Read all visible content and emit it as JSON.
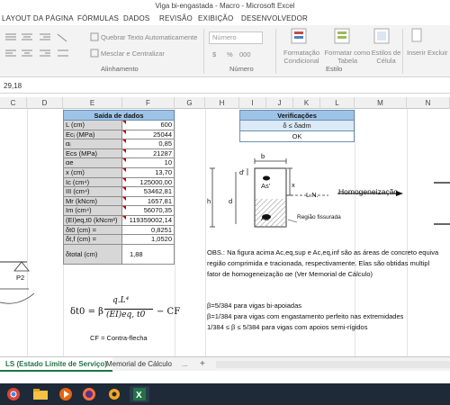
{
  "window": {
    "title": "Viga bi-engastada - Macro - Microsoft Excel"
  },
  "menu": [
    "LAYOUT DA PÁGINA",
    "FÓRMULAS",
    "DADOS",
    "REVISÃO",
    "EXIBIÇÃO",
    "DESENVOLVEDOR"
  ],
  "ribbon": {
    "wrap_text": "Quebrar Texto Automaticamente",
    "merge_center": "Mesclar e Centralizar",
    "number_format": "Número",
    "cond_format": "Formatação Condicional",
    "format_table": "Formatar como Tabela",
    "cell_styles": "Estilos de Célula",
    "insert": "Inserir",
    "delete": "Excluir",
    "group_alignment": "Alinhamento",
    "group_number": "Número",
    "group_style": "Estilo",
    "currency_symbol": "$",
    "percent_symbol": "%",
    "thousands_symbol": "000"
  },
  "formula_bar": {
    "name_box": "29,18"
  },
  "columns": [
    "C",
    "D",
    "E",
    "F",
    "G",
    "H",
    "I",
    "J",
    "K",
    "L",
    "M",
    "N"
  ],
  "output_table": {
    "header": "Saída de dados",
    "rows": [
      {
        "label": "L (cm)",
        "value": "600"
      },
      {
        "label": "Ecᵢ (MPa)",
        "value": "25044"
      },
      {
        "label": "αᵢ",
        "value": "0,85"
      },
      {
        "label": "Ecs (MPa)",
        "value": "21287"
      },
      {
        "label": "αe",
        "value": "10"
      },
      {
        "label": "x (cm)",
        "value": "13,70"
      },
      {
        "label": "Ic (cm⁴)",
        "value": "125000,00"
      },
      {
        "label": "III (cm⁴)",
        "value": "53462,81"
      },
      {
        "label": "Mr (kNcm)",
        "value": "1657,81"
      },
      {
        "label": "Im (cm⁴)",
        "value": "56070,35"
      },
      {
        "label": "(EI)eq,t0 (kNcm²)",
        "value": "119359002,14"
      },
      {
        "label": "δt0 (cm) =",
        "value": "0,8251"
      },
      {
        "label": "δt,f (cm) =",
        "value": "1,0520"
      },
      {
        "label": "δtotal (cm)",
        "value": "1,88"
      }
    ]
  },
  "verification": {
    "header": "Verificações",
    "condition": "δ ≤ δadm",
    "result": "OK"
  },
  "diagram": {
    "label_b": "b",
    "label_h": "h",
    "label_d": "d",
    "label_dprime": "d'",
    "label_x": "x",
    "label_as_prime": "As'",
    "label_as": "As",
    "label_ln": "L.N.",
    "label_cracked": "Região fissurada",
    "arrow_text": "Homogeneização"
  },
  "notes": {
    "obs_line1": "OBS.: Na figura acima Ac,eq,sup e Ac,eq,inf são as áreas de concreto equiva",
    "obs_line2": "região comprimida e tracionada, respectivamente. Elas são obtidas multipl",
    "obs_line3": "fator de homogeneização αe (Ver Memorial de Cálculo)",
    "beta1": "β=5/384   para vigas bi-apoiadas",
    "beta2": "β=1/384   para vigas com engastamento perfeito nas extremidades",
    "beta3": "1/384 ≤ β ≤ 5/384   para vigas com apoios semi-rígidos"
  },
  "formula": {
    "lhs": "δt0 = β",
    "numerator": "q.L⁴",
    "denominator": "(EI)eq, t0",
    "rhs": "− CF",
    "cf_note": "CF = Contra-flecha"
  },
  "left_fragment": {
    "label_p2": "P2"
  },
  "tabs": {
    "active": "LS (Estado Limite de Serviço)",
    "other": "Memorial de Cálculo",
    "dots": "...",
    "add": "+"
  },
  "colors": {
    "header_blue": "#9dc3e6",
    "label_gray": "#d7d7d7",
    "active_tab_green": "#217346",
    "taskbar": "#1e2a38"
  }
}
